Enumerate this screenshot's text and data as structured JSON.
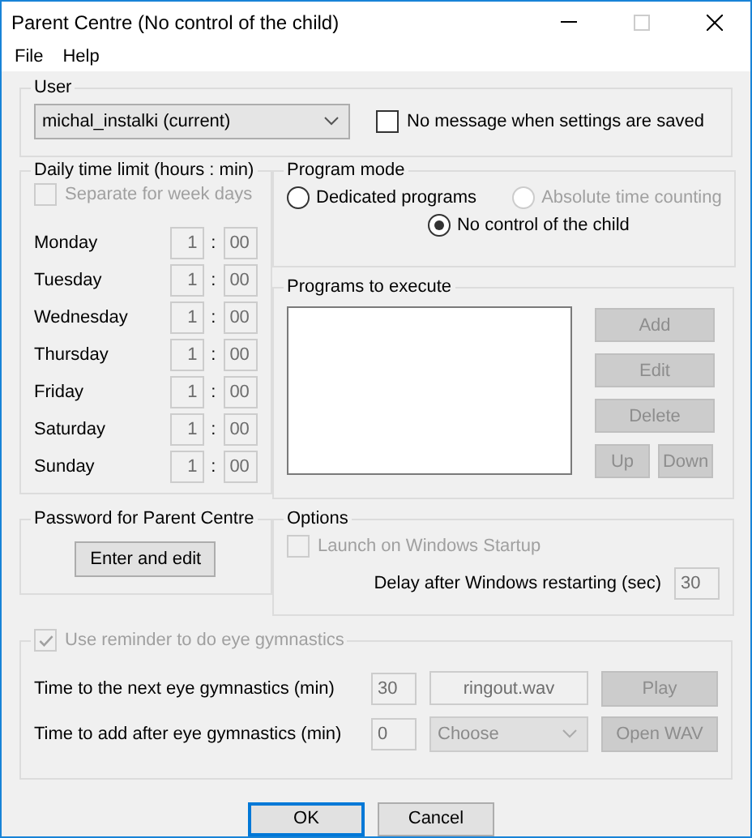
{
  "window": {
    "title": "Parent Centre (No control of the child)"
  },
  "menu": [
    {
      "label": "File"
    },
    {
      "label": "Help"
    }
  ],
  "user": {
    "title": "User",
    "value": "michal_instalki (current)",
    "no_message": {
      "label": "No message when settings are saved",
      "checked": false
    }
  },
  "daily_limit": {
    "title": "Daily time limit (hours : min)",
    "separate": {
      "label": "Separate for week days",
      "checked": false,
      "disabled": true
    },
    "separator": ":",
    "days": [
      {
        "name": "Monday",
        "hours": "1",
        "minutes": "00"
      },
      {
        "name": "Tuesday",
        "hours": "1",
        "minutes": "00"
      },
      {
        "name": "Wednesday",
        "hours": "1",
        "minutes": "00"
      },
      {
        "name": "Thursday",
        "hours": "1",
        "minutes": "00"
      },
      {
        "name": "Friday",
        "hours": "1",
        "minutes": "00"
      },
      {
        "name": "Saturday",
        "hours": "1",
        "minutes": "00"
      },
      {
        "name": "Sunday",
        "hours": "1",
        "minutes": "00"
      }
    ]
  },
  "password": {
    "title": "Password for Parent Centre",
    "button": "Enter and edit"
  },
  "program_mode": {
    "title": "Program mode",
    "options": [
      {
        "label": "Dedicated programs",
        "selected": false,
        "disabled": false
      },
      {
        "label": "Absolute time counting",
        "selected": false,
        "disabled": true
      },
      {
        "label": "No control of the child",
        "selected": true,
        "disabled": false
      }
    ]
  },
  "programs": {
    "title": "Programs to execute",
    "buttons": [
      {
        "label": "Add",
        "kind": "wide",
        "disabled": true
      },
      {
        "label": "Edit",
        "kind": "wide",
        "disabled": true
      },
      {
        "label": "Delete",
        "kind": "wide",
        "disabled": true
      },
      {
        "label": "Up",
        "kind": "half",
        "disabled": true
      },
      {
        "label": "Down",
        "kind": "half",
        "disabled": true
      }
    ]
  },
  "options": {
    "title": "Options",
    "launch": {
      "label": "Launch on Windows Startup",
      "checked": false,
      "disabled": true
    },
    "delay": {
      "label": "Delay after Windows restarting (sec)",
      "value": "30"
    }
  },
  "eye": {
    "reminder": {
      "label": "Use reminder to do eye gymnastics",
      "checked": true,
      "disabled": true
    },
    "rows": [
      {
        "label": "Time to the next eye gymnastics (min)",
        "value": "30"
      },
      {
        "label": "Time to add after eye gymnastics (min)",
        "value": "0"
      }
    ],
    "sound_file": "ringout.wav",
    "sound_choice": "Choose",
    "play": {
      "label": "Play",
      "disabled": true
    },
    "open": {
      "label": "Open WAV",
      "disabled": true
    }
  },
  "buttons": [
    {
      "label": "OK",
      "default": true
    },
    {
      "label": "Cancel",
      "default": false
    }
  ]
}
